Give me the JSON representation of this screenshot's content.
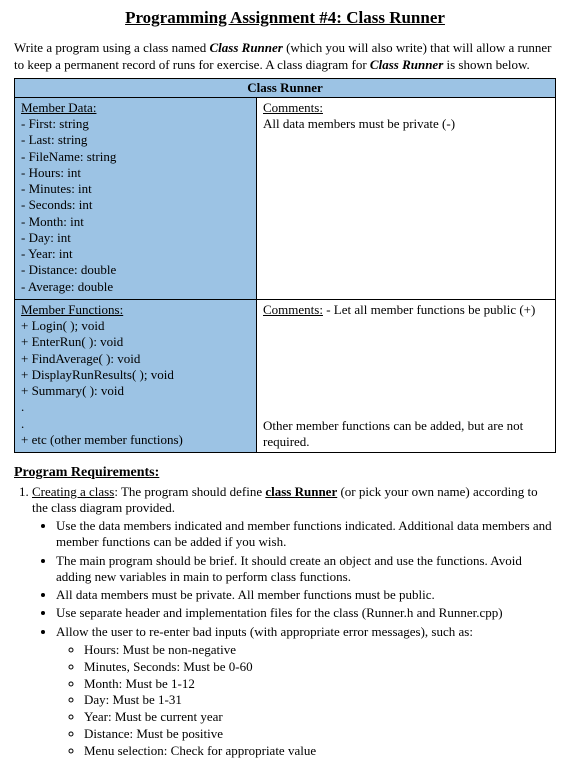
{
  "title": "Programming Assignment #4:  Class Runner",
  "intro_pre": "Write a program using a class named ",
  "intro_class": "Class Runner",
  "intro_mid": " (which you will also write) that will allow a runner to keep a permanent record of runs for exercise.  A class diagram for ",
  "intro_class2": "Class Runner",
  "intro_post": " is shown below.",
  "diagram": {
    "class_name": "Class Runner",
    "member_data_heading": "Member Data:",
    "member_data_items": [
      "- First: string",
      "- Last: string",
      "- FileName: string",
      "- Hours: int",
      "- Minutes: int",
      "- Seconds: int",
      "- Month: int",
      "- Day: int",
      "- Year: int",
      "- Distance: double",
      "- Average: double"
    ],
    "comments1_heading": "Comments:",
    "comments1_text": "All data members must be private (-)",
    "member_funcs_heading": "Member Functions:",
    "member_funcs_items": [
      "+ Login( ); void",
      "+ EnterRun( ):  void",
      "+ FindAverage( ):  void",
      "+ DisplayRunResults( ); void",
      "+ Summary( ):  void",
      ".",
      ".",
      "+ etc (other member functions)"
    ],
    "comments2_label": "Comments:",
    "comments2_text": " - Let all member functions be public (+)",
    "comments2_bottom": "Other member functions can be added, but are not required."
  },
  "requirements_heading": "Program Requirements:",
  "req1_pre": "Creating a class",
  "req1_mid": ":  The program should define ",
  "req1_bold": "class Runner",
  "req1_post": " (or pick your own name) according to the class diagram provided.",
  "bullets": [
    "Use the data members indicated and member functions indicated.  Additional data members and member functions can be added if you wish.",
    "The main program should be brief.  It should create an object and use the functions.  Avoid adding new variables in main to perform class functions.",
    "All data members must be private.  All member functions must be public.",
    "Use separate header and implementation files for the class (Runner.h and Runner.cpp)",
    "Allow the user to re-enter bad inputs (with appropriate error messages), such as:"
  ],
  "validation": [
    "Hours:  Must be non-negative",
    "Minutes, Seconds:  Must be 0-60",
    "Month:  Must be 1-12",
    "Day:  Must be 1-31",
    "Year:  Must be current year",
    "Distance:  Must be positive",
    "Menu selection:  Check for appropriate value"
  ]
}
